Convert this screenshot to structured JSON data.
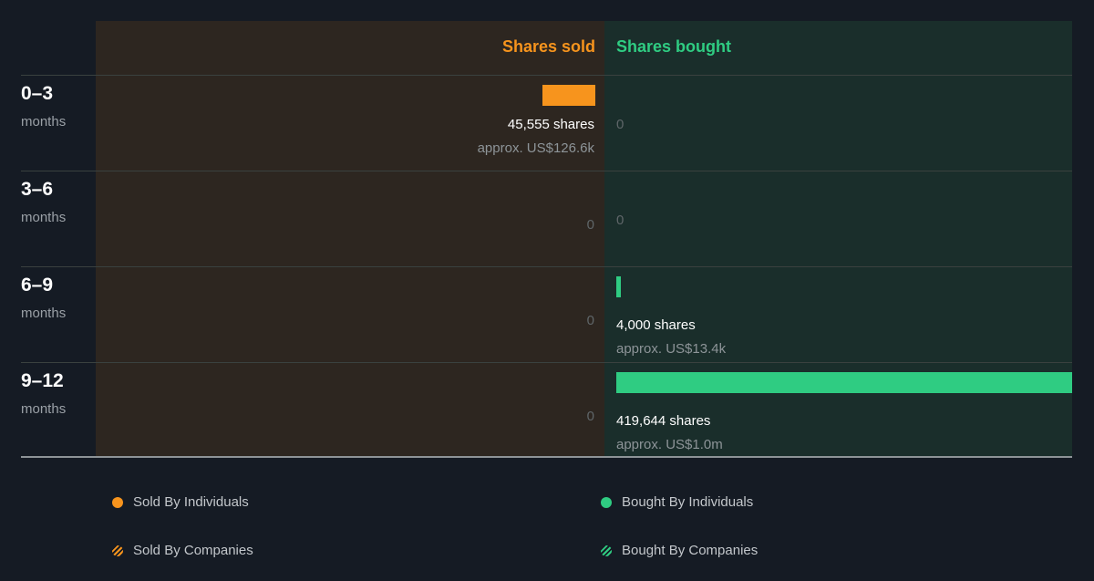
{
  "colors": {
    "sold": "#f7941d",
    "bought": "#2fcc82",
    "sold_panel": "#2d2620",
    "bought_panel": "#1a2e2b",
    "background": "#151b24"
  },
  "chart_data": {
    "type": "bar",
    "orientation": "horizontal-diverging",
    "columns": {
      "sold": "Shares sold",
      "bought": "Shares bought"
    },
    "rows": [
      {
        "period": "0–3",
        "unit": "months",
        "sold": 45555,
        "sold_shares_label": "45,555 shares",
        "sold_approx_label": "approx. US$126.6k",
        "bought": 0,
        "bought_shares_label": "",
        "bought_approx_label": ""
      },
      {
        "period": "3–6",
        "unit": "months",
        "sold": 0,
        "sold_shares_label": "",
        "sold_approx_label": "",
        "bought": 0,
        "bought_shares_label": "",
        "bought_approx_label": ""
      },
      {
        "period": "6–9",
        "unit": "months",
        "sold": 0,
        "sold_shares_label": "",
        "sold_approx_label": "",
        "bought": 4000,
        "bought_shares_label": "4,000 shares",
        "bought_approx_label": "approx. US$13.4k"
      },
      {
        "period": "9–12",
        "unit": "months",
        "sold": 0,
        "sold_shares_label": "",
        "sold_approx_label": "",
        "bought": 419644,
        "bought_shares_label": "419,644 shares",
        "bought_approx_label": "approx. US$1.0m"
      }
    ],
    "zero_label": "0",
    "max_value": 419644,
    "legend": [
      {
        "label": "Sold By Individuals",
        "kind": "sold",
        "pattern": "solid"
      },
      {
        "label": "Bought By Individuals",
        "kind": "bought",
        "pattern": "solid"
      },
      {
        "label": "Sold By Companies",
        "kind": "sold",
        "pattern": "striped"
      },
      {
        "label": "Bought By Companies",
        "kind": "bought",
        "pattern": "striped"
      }
    ]
  }
}
